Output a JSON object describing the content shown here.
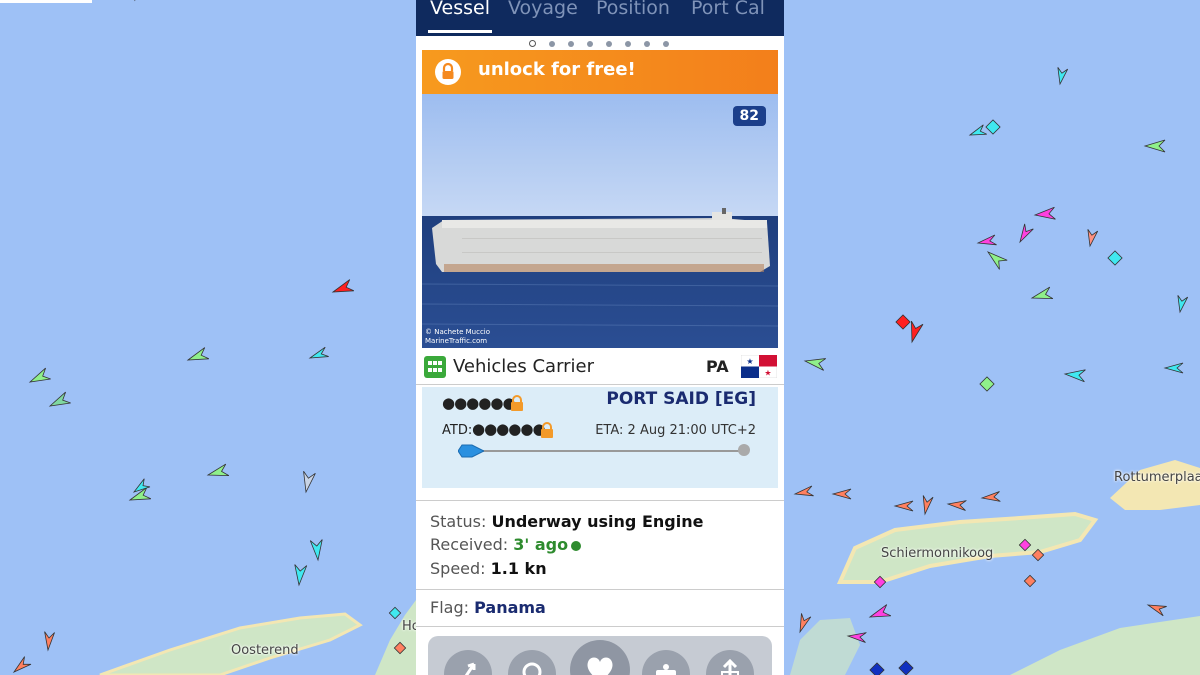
{
  "tabs": [
    {
      "label": "Vessel",
      "active": true
    },
    {
      "label": "Voyage",
      "active": false
    },
    {
      "label": "Position",
      "active": false
    },
    {
      "label": "Port Cal",
      "active": false
    }
  ],
  "pager": {
    "total": 8,
    "active": 1
  },
  "unlock_banner": {
    "label": "unlock for free!",
    "icon": "lock-icon"
  },
  "photo": {
    "photo_count": "82",
    "credit_author": "© Nachete Muccio",
    "credit_site": "MarineTraffic.com"
  },
  "vessel": {
    "type": "Vehicles Carrier",
    "type_icon": "vessel-type-grid-icon",
    "flag_code": "PA",
    "flag": "Panama",
    "flag_colors": {
      "blue": "#0b2e8a",
      "red": "#d21034",
      "white": "#ffffff"
    }
  },
  "voyage": {
    "origin_masked": "●●●●●●",
    "destination": "PORT SAID [EG]",
    "atd_label": "ATD:",
    "atd_masked": "●●●●●●",
    "eta_label": "ETA:",
    "eta_value": "2 Aug 21:00 UTC+2",
    "progress": 0
  },
  "status": {
    "status_label": "Status:",
    "status_value": "Underway using Engine",
    "received_label": "Received:",
    "received_value": "3' ago",
    "speed_label": "Speed:",
    "speed_value": "1.1 kn"
  },
  "flag_row": {
    "label": "Flag:",
    "value": "Panama"
  },
  "map_labels": [
    "Rottumerplaat",
    "Schiermonnikoog",
    "Oosterend",
    "Ho"
  ],
  "colors": {
    "accent_orange": "#f58a1f",
    "header_navy": "#0f2a5e",
    "sea": "#9ec1f6",
    "land": "#cfe6c6",
    "sand": "#f3e7b3",
    "status_green": "#2e8b2e"
  },
  "actions": [
    "route-icon",
    "port-pin-icon",
    "heart-icon",
    "camera-icon",
    "share-icon"
  ]
}
